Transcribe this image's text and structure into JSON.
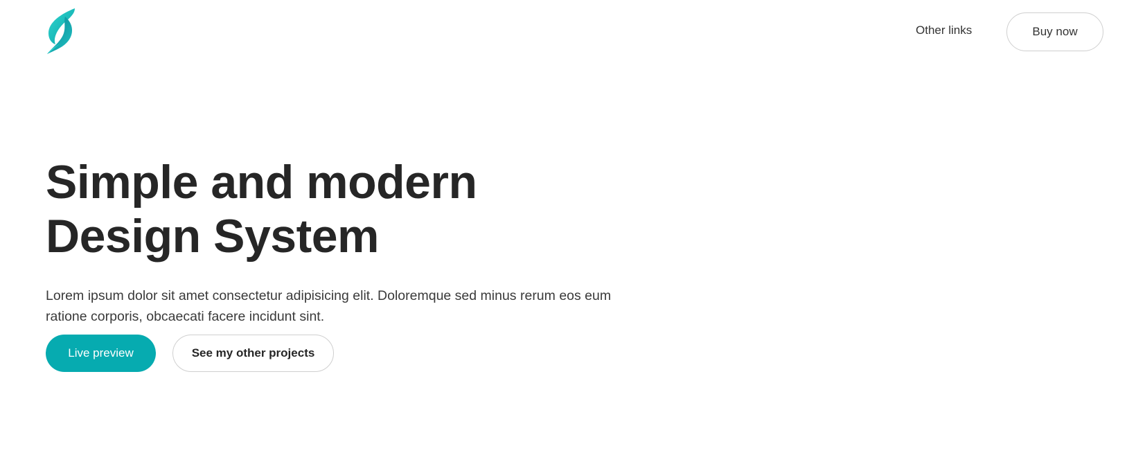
{
  "header": {
    "logo_icon": "leaf-swirl-logo",
    "nav_link_label": "Other links",
    "buy_label": "Buy now"
  },
  "hero": {
    "title": "Simple and modern Design System",
    "description": "Lorem ipsum dolor sit amet consectetur adipisicing elit. Doloremque sed minus rerum eos eum ratione corporis, obcaecati facere incidunt sint.",
    "primary_button_label": "Live preview",
    "secondary_button_label": "See my other projects"
  },
  "colors": {
    "accent": "#06abb0",
    "text_dark": "#262626",
    "border": "#cfcfcf"
  }
}
